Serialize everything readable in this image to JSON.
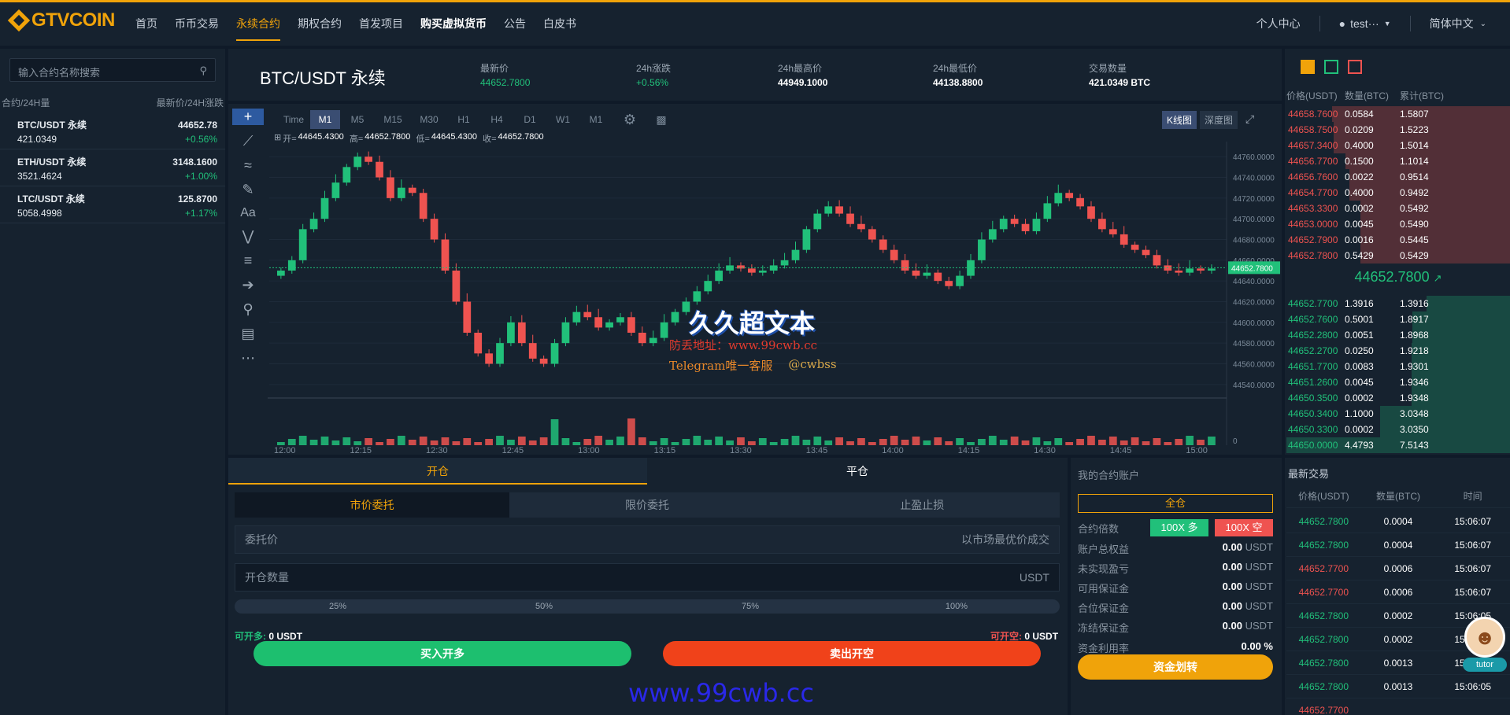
{
  "header": {
    "logo": "GTVCOIN",
    "nav": [
      "首页",
      "币币交易",
      "永续合约",
      "期权合约",
      "首发项目",
      "购买虚拟货币",
      "公告",
      "白皮书"
    ],
    "user_center": "个人中心",
    "username": "test···",
    "language": "简体中文"
  },
  "markets": {
    "search_placeholder": "输入合约名称搜索",
    "col_left": "合约/24H量",
    "col_right": "最新价/24H涨跌",
    "items": [
      {
        "name": "BTC/USDT 永续",
        "vol": "421.0349",
        "price": "44652.78",
        "change": "+0.56%"
      },
      {
        "name": "ETH/USDT 永续",
        "vol": "3521.4624",
        "price": "3148.1600",
        "change": "+1.00%"
      },
      {
        "name": "LTC/USDT 永续",
        "vol": "5058.4998",
        "price": "125.8700",
        "change": "+1.17%"
      }
    ]
  },
  "ticker": {
    "pair": "BTC/USDT 永续",
    "last_label": "最新价",
    "last": "44652.7800",
    "chg_label": "24h涨跌",
    "chg": "+0.56%",
    "high_label": "24h最高价",
    "high": "44949.1000",
    "low_label": "24h最低价",
    "low": "44138.8800",
    "vol_label": "交易数量",
    "vol": "421.0349 BTC"
  },
  "chart_toolbar": {
    "intervals": [
      "Time",
      "M1",
      "M5",
      "M15",
      "M30",
      "H1",
      "H4",
      "D1",
      "W1",
      "M1"
    ],
    "active": "M1",
    "kline": "K线图",
    "depth": "深度图"
  },
  "ohlc": {
    "o_label": "开=",
    "o": "44645.4300",
    "h_label": "高=",
    "h": "44652.7800",
    "l_label": "低=",
    "l": "44645.4300",
    "c_label": "收=",
    "c": "44652.7800"
  },
  "chart_data": {
    "type": "candlestick",
    "y_ticks": [
      "44760.0000",
      "44740.0000",
      "44720.0000",
      "44700.0000",
      "44680.0000",
      "44660.0000",
      "44640.0000",
      "44620.0000",
      "44600.0000",
      "44580.0000",
      "44560.0000",
      "44540.0000"
    ],
    "ylim": [
      44530,
      44770
    ],
    "x_ticks": [
      "12:00",
      "12:15",
      "12:30",
      "12:45",
      "13:00",
      "13:15",
      "13:30",
      "13:45",
      "14:00",
      "14:15",
      "14:30",
      "14:45",
      "15:00"
    ],
    "last_price": "44652.7800",
    "volume_zero": "0",
    "closes": [
      44650,
      44660,
      44690,
      44700,
      44720,
      44735,
      44750,
      44760,
      44755,
      44740,
      44720,
      44730,
      44725,
      44700,
      44680,
      44650,
      44620,
      44590,
      44570,
      44560,
      44580,
      44600,
      44580,
      44565,
      44560,
      44580,
      44600,
      44610,
      44605,
      44595,
      44600,
      44605,
      44590,
      44580,
      44585,
      44600,
      44610,
      44620,
      44630,
      44640,
      44650,
      44655,
      44652,
      44648,
      44650,
      44655,
      44660,
      44670,
      44690,
      44705,
      44712,
      44705,
      44695,
      44690,
      44680,
      44670,
      44660,
      44650,
      44645,
      44648,
      44640,
      44635,
      44645,
      44660,
      44680,
      44690,
      44700,
      44695,
      44688,
      44700,
      44715,
      44725,
      44720,
      44712,
      44700,
      44690,
      44685,
      44675,
      44670,
      44665,
      44655,
      44650,
      44648,
      44652,
      44650,
      44652
    ]
  },
  "orderbook": {
    "h_price": "价格(USDT)",
    "h_qty": "数量(BTC)",
    "h_cum": "累计(BTC)",
    "asks": [
      [
        "44658.7600",
        "0.0584",
        "1.5807"
      ],
      [
        "44658.7500",
        "0.0209",
        "1.5223"
      ],
      [
        "44657.3400",
        "0.4000",
        "1.5014"
      ],
      [
        "44656.7700",
        "0.1500",
        "1.1014"
      ],
      [
        "44656.7600",
        "0.0022",
        "0.9514"
      ],
      [
        "44654.7700",
        "0.4000",
        "0.9492"
      ],
      [
        "44653.3300",
        "0.0002",
        "0.5492"
      ],
      [
        "44653.0000",
        "0.0045",
        "0.5490"
      ],
      [
        "44652.7900",
        "0.0016",
        "0.5445"
      ],
      [
        "44652.7800",
        "0.5429",
        "0.5429"
      ]
    ],
    "mid": "44652.7800",
    "bids": [
      [
        "44652.7700",
        "1.3916",
        "1.3916"
      ],
      [
        "44652.7600",
        "0.5001",
        "1.8917"
      ],
      [
        "44652.2800",
        "0.0051",
        "1.8968"
      ],
      [
        "44652.2700",
        "0.0250",
        "1.9218"
      ],
      [
        "44651.7700",
        "0.0083",
        "1.9301"
      ],
      [
        "44651.2600",
        "0.0045",
        "1.9346"
      ],
      [
        "44650.3500",
        "0.0002",
        "1.9348"
      ],
      [
        "44650.3400",
        "1.1000",
        "3.0348"
      ],
      [
        "44650.3300",
        "0.0002",
        "3.0350"
      ],
      [
        "44650.0000",
        "4.4793",
        "7.5143"
      ]
    ]
  },
  "order": {
    "tab_open": "开仓",
    "tab_close": "平仓",
    "types": [
      "市价委托",
      "限价委托",
      "止盈止损"
    ],
    "price_label": "委托价",
    "price_hint": "以市场最优价成交",
    "qty_label": "开仓数量",
    "qty_unit": "USDT",
    "pcts": [
      "25%",
      "50%",
      "75%",
      "100%"
    ],
    "can_long_label": "可开多:",
    "can_long": "0 USDT",
    "can_short_label": "可开空:",
    "can_short": "0 USDT",
    "buy": "买入开多",
    "sell": "卖出开空"
  },
  "account": {
    "title": "我的合约账户",
    "mode": "全仓",
    "lev_label": "合约倍数",
    "lev_long": "100X 多",
    "lev_short": "100X 空",
    "rows": [
      [
        "账户总权益",
        "0.00",
        "USDT"
      ],
      [
        "未实现盈亏",
        "0.00",
        "USDT"
      ],
      [
        "可用保证金",
        "0.00",
        "USDT"
      ],
      [
        "合位保证金",
        "0.00",
        "USDT"
      ],
      [
        "冻结保证金",
        "0.00",
        "USDT"
      ]
    ],
    "util_label": "资金利用率",
    "util": "0.00 %",
    "transfer": "资金划转"
  },
  "trades": {
    "title": "最新交易",
    "h_price": "价格(USDT)",
    "h_qty": "数量(BTC)",
    "h_time": "时间",
    "rows": [
      [
        "44652.7800",
        "0.0004",
        "15:06:07",
        "g"
      ],
      [
        "44652.7800",
        "0.0004",
        "15:06:07",
        "g"
      ],
      [
        "44652.7700",
        "0.0006",
        "15:06:07",
        "r"
      ],
      [
        "44652.7700",
        "0.0006",
        "15:06:07",
        "r"
      ],
      [
        "44652.7800",
        "0.0002",
        "15:06:05",
        "g"
      ],
      [
        "44652.7800",
        "0.0002",
        "15:06:05",
        "g"
      ],
      [
        "44652.7800",
        "0.0013",
        "15:06:05",
        "g"
      ],
      [
        "44652.7800",
        "0.0013",
        "15:06:05",
        "g"
      ],
      [
        "44652.7700",
        "",
        "",
        "r"
      ]
    ]
  },
  "watermark": {
    "title": "久久超文本",
    "line1": "防丢地址：www.99cwb.cc",
    "line2a": "Telegram唯一客服",
    "line2b": "@cwbss",
    "bottom": "www.99cwb.cc"
  },
  "tutor": "tutor",
  "colors": {
    "accent": "#f0a30a",
    "up": "#21c07a",
    "down": "#ef5350"
  }
}
